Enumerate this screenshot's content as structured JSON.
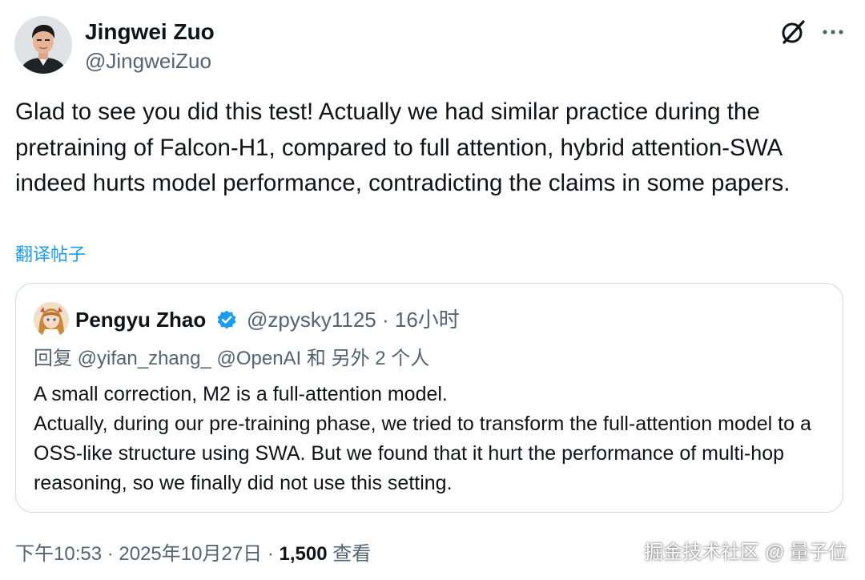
{
  "author": {
    "name": "Jingwei Zuo",
    "handle": "@JingweiZuo",
    "avatar_icon": "person-portrait-avatar"
  },
  "header_actions": {
    "grok_icon": "grok-slash-circle-icon",
    "more_icon": "more-horizontal-icon"
  },
  "tweet": {
    "text": "Glad to see you did this test! Actually we had similar practice during the pretraining of Falcon-H1, compared to full attention, hybrid attention-SWA indeed hurts model performance, contradicting the claims in some papers.",
    "translate_label": "翻译帖子"
  },
  "quote": {
    "name": "Pengyu Zhao",
    "verified_icon": "verified-badge-icon",
    "verified_color": "#1d9bf0",
    "meta": "@zpysky1125 · 16小时",
    "reply_to": "回复 @yifan_zhang_ @OpenAI 和 另外 2 个人",
    "text": "A small correction, M2 is a full-attention model.\nActually, during our pre-training phase, we tried to transform the full-attention model to a OSS-like structure using SWA. But we found that it hurt the performance of multi-hop reasoning, so we finally did not use this setting."
  },
  "footer": {
    "timestamp": "下午10:53 · 2025年10月27日 · ",
    "views_count": "1,500",
    "views_label": " 查看"
  },
  "watermark": "掘金技术社区 @ 量子位",
  "colors": {
    "text": "#0f1419",
    "secondary": "#536471",
    "link": "#1d9bf0",
    "border": "#cfd9de"
  }
}
